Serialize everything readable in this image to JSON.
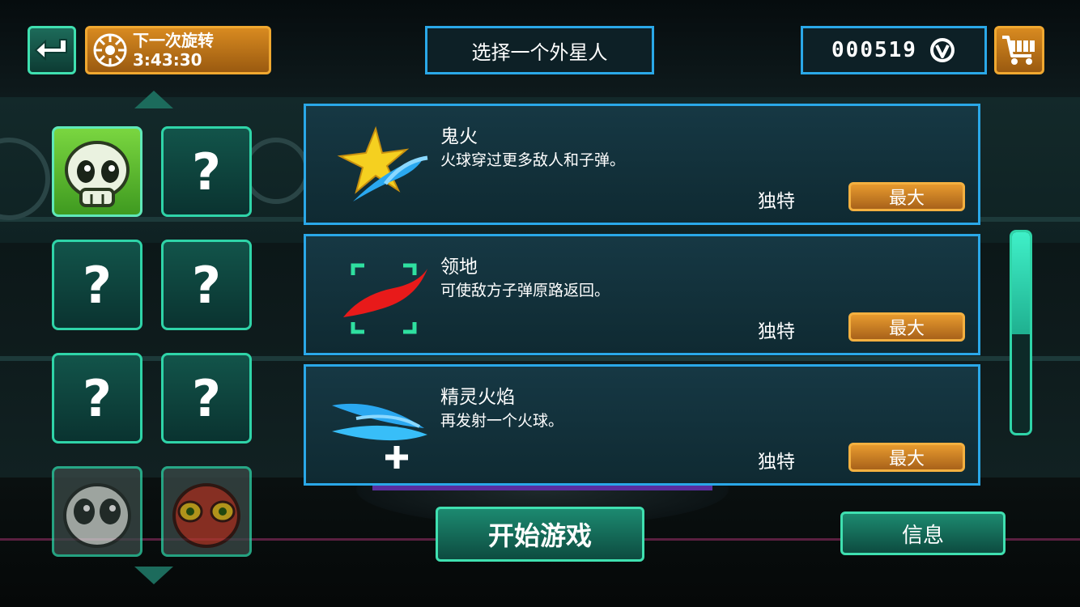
{
  "header": {
    "back_icon": "back-arrow-icon",
    "spin_label": "下一次旋转",
    "spin_timer": "3:43:30",
    "title": "选择一个外星人",
    "coins": "000519",
    "coin_icon": "currency-icon",
    "cart_icon": "cart-icon"
  },
  "aliens": [
    {
      "state": "selected",
      "icon": "skull-alien-icon"
    },
    {
      "state": "locked",
      "label": "?"
    },
    {
      "state": "locked",
      "label": "?"
    },
    {
      "state": "locked",
      "label": "?"
    },
    {
      "state": "locked",
      "label": "?"
    },
    {
      "state": "locked",
      "label": "?"
    },
    {
      "state": "dim",
      "icon": "grey-alien-icon"
    },
    {
      "state": "dim",
      "icon": "red-alien-icon"
    }
  ],
  "abilities": [
    {
      "name": "鬼火",
      "desc": "火球穿过更多敌人和子弹。",
      "tag": "独特",
      "button": "最大",
      "icon": "ghost-fire-icon"
    },
    {
      "name": "领地",
      "desc": "可使敌方子弹原路返回。",
      "tag": "独特",
      "button": "最大",
      "icon": "territory-icon"
    },
    {
      "name": "精灵火焰",
      "desc": "再发射一个火球。",
      "tag": "独特",
      "button": "最大",
      "icon": "sprite-flame-icon"
    }
  ],
  "scroll": {
    "position": 0.5
  },
  "footer": {
    "start_label": "开始游戏",
    "info_label": "信息"
  },
  "colors": {
    "accent_teal": "#2fd4a8",
    "accent_blue": "#2aa8e8",
    "accent_orange": "#f0a830"
  }
}
